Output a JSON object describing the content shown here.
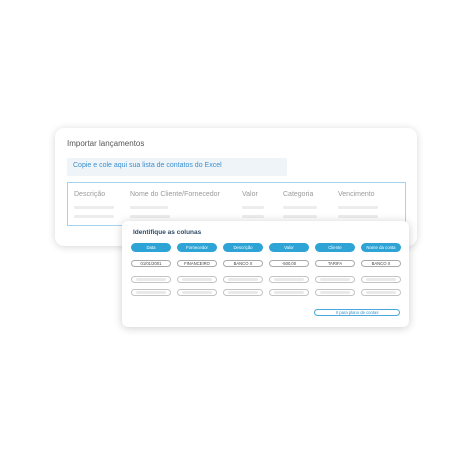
{
  "import_card": {
    "title": "Importar lançamentos",
    "paste_hint": "Copie e cole aqui sua lista de contatos do Excel",
    "columns": [
      "Descrição",
      "Nome do Cliente/Fornecedor",
      "Valor",
      "Categoria",
      "Vencimento"
    ]
  },
  "identify_card": {
    "title": "Identifique as colunas",
    "column_buttons": [
      "Data",
      "Fornecedor",
      "Descrição",
      "Valor",
      "Cliente",
      "Nome da conta"
    ],
    "sample_row": [
      "01/01/2001",
      "FINANCEIRO",
      "BANCO X",
      "-500,00",
      "TARIFA",
      "BANCO X"
    ],
    "next_button": "Ir para plano de contas"
  },
  "colors": {
    "accent": "#2ea4d6",
    "table_border": "#a7d2ef",
    "link_text": "#3a8fd0"
  }
}
